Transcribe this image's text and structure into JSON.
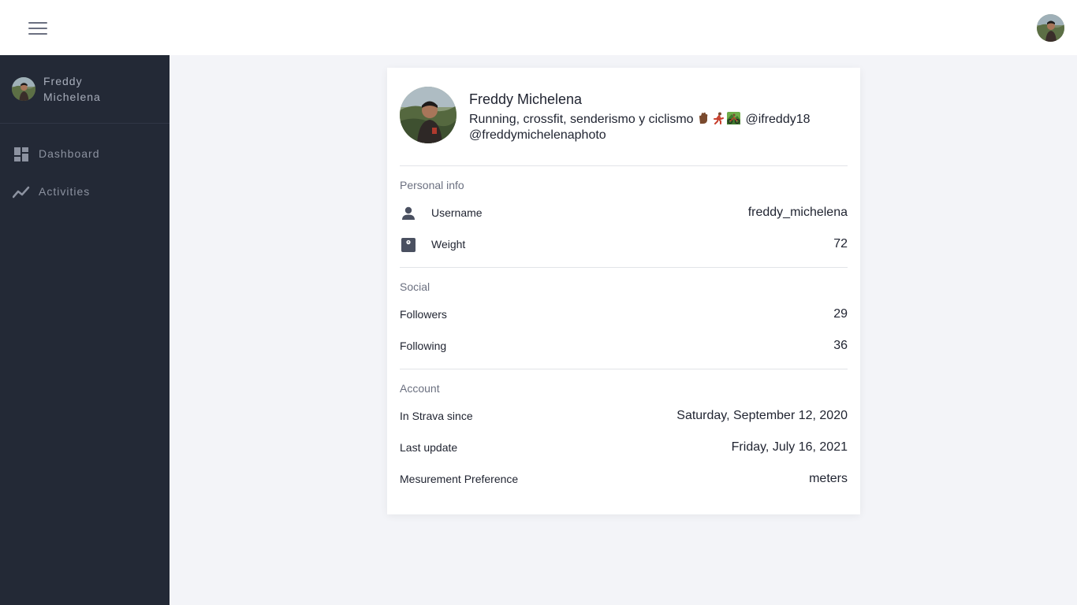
{
  "sidebar": {
    "user_name": "Freddy Michelena",
    "nav": [
      {
        "label": "Dashboard",
        "icon": "dashboard-icon"
      },
      {
        "label": "Activities",
        "icon": "activity-chart-icon"
      }
    ]
  },
  "profile": {
    "name": "Freddy Michelena",
    "bio_text": "Running, crossfit, senderismo y ciclismo",
    "bio_emojis": [
      "hand-icon",
      "runner-icon",
      "mountain-biker-icon"
    ],
    "bio_handles": "@ifreddy18 @freddymichelenaphoto"
  },
  "sections": {
    "personal": {
      "title": "Personal info",
      "username_label": "Username",
      "username_value": "freddy_michelena",
      "weight_label": "Weight",
      "weight_value": "72"
    },
    "social": {
      "title": "Social",
      "followers_label": "Followers",
      "followers_value": "29",
      "following_label": "Following",
      "following_value": "36"
    },
    "account": {
      "title": "Account",
      "since_label": "In Strava since",
      "since_value": "Saturday, September 12, 2020",
      "update_label": "Last update",
      "update_value": "Friday, July 16, 2021",
      "pref_label": "Mesurement Preference",
      "pref_value": "meters"
    }
  },
  "colors": {
    "sidebar_bg": "#232936",
    "page_bg": "#f3f4f8",
    "card_bg": "#ffffff",
    "muted_text": "#6b7080",
    "nav_text": "#8c92a0"
  }
}
